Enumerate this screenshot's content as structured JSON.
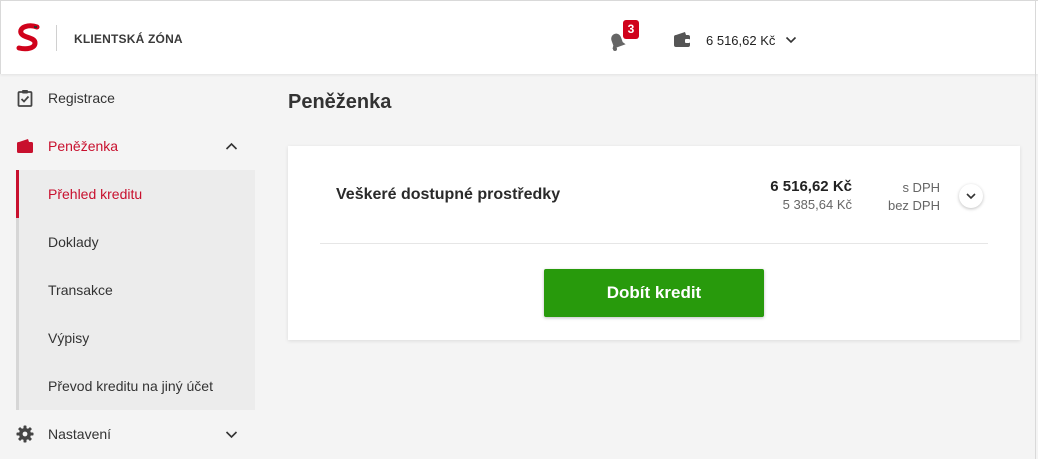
{
  "header": {
    "app_title": "KLIENTSKÁ ZÓNA",
    "notifications_count": "3",
    "wallet_amount": "6 516,62 Kč",
    "icons": [
      "logo",
      "bell-icon",
      "wallet-icon",
      "chevron-down-icon"
    ]
  },
  "sidebar": {
    "items": [
      {
        "label": "Registrace",
        "icon": "clipboard-check-icon"
      },
      {
        "label": "Peněženka",
        "icon": "wallet-icon",
        "expanded": true
      },
      {
        "label": "Nastavení",
        "icon": "gear-icon",
        "expanded": false
      }
    ],
    "wallet_subitems": [
      {
        "label": "Přehled kreditu",
        "current": true
      },
      {
        "label": "Doklady"
      },
      {
        "label": "Transakce"
      },
      {
        "label": "Výpisy"
      },
      {
        "label": "Převod kreditu na jiný účet"
      }
    ]
  },
  "main": {
    "page_title": "Peněženka",
    "card": {
      "label": "Veškeré dostupné prostředky",
      "amount_with_vat": "6 516,62 Kč",
      "amount_without_vat": "5 385,64 Kč",
      "with_vat_label": "s DPH",
      "without_vat_label": "bez DPH",
      "topup_button": "Dobít kredit"
    }
  },
  "colors": {
    "brand_red": "#c8102e",
    "button_green": "#289a0c",
    "badge_red": "#d0021b"
  }
}
